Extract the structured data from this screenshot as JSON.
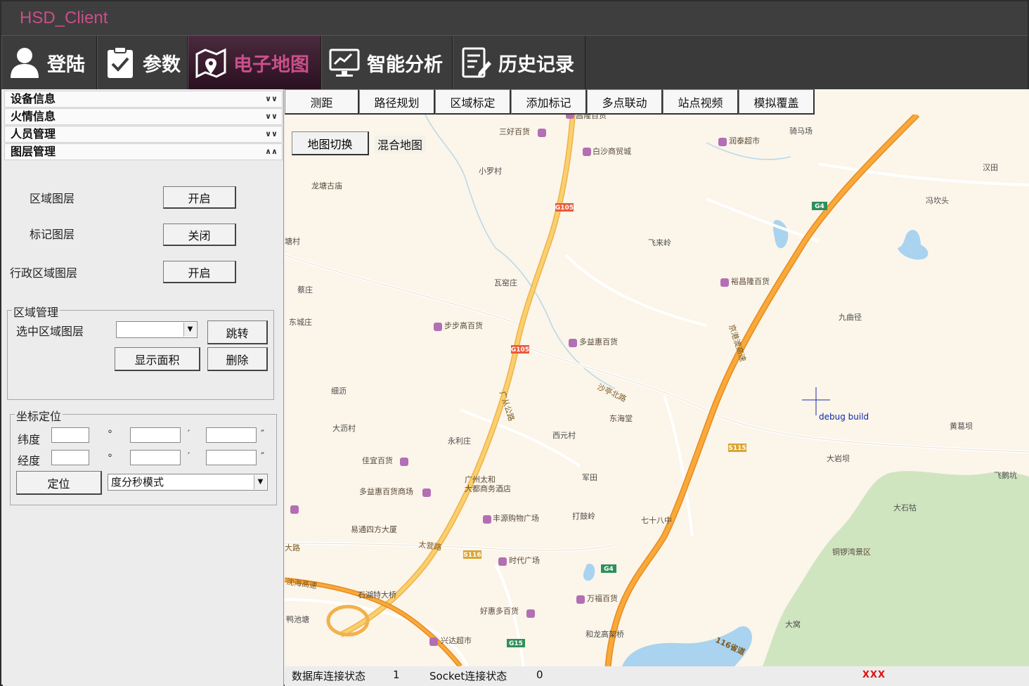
{
  "window": {
    "title": "HSD_Client"
  },
  "main_tabs": [
    {
      "label": "登陆",
      "icon": "user-icon"
    },
    {
      "label": "参数",
      "icon": "clipboard-check-icon"
    },
    {
      "label": "电子地图",
      "icon": "map-pin-icon",
      "active": true
    },
    {
      "label": "智能分析",
      "icon": "monitor-analysis-icon"
    },
    {
      "label": "历史记录",
      "icon": "edit-document-icon"
    }
  ],
  "accordion": [
    {
      "label": "设备信息",
      "expanded": false
    },
    {
      "label": "火情信息",
      "expanded": false
    },
    {
      "label": "人员管理",
      "expanded": false
    },
    {
      "label": "图层管理",
      "expanded": true
    }
  ],
  "layers": {
    "area_label": "区域图层",
    "area_btn": "开启",
    "marker_label": "标记图层",
    "marker_btn": "关闭",
    "admin_label": "行政区域图层",
    "admin_btn": "开启"
  },
  "area_mgmt": {
    "title": "区域管理",
    "select_label": "选中区域图层",
    "select_value": "",
    "jump_btn": "跳转",
    "show_area_btn": "显示面积",
    "delete_btn": "删除"
  },
  "coord": {
    "title": "坐标定位",
    "lat_label": "纬度",
    "lon_label": "经度",
    "deg_sym": "°",
    "min_sym": "′",
    "sec_sym": "″",
    "locate_btn": "定位",
    "mode_value": "度分秒模式"
  },
  "map_tools": [
    "测距",
    "路径规划",
    "区域标定",
    "添加标记",
    "多点联动",
    "站点视频",
    "模拟覆盖"
  ],
  "map": {
    "switch_btn": "地图切换",
    "map_type": "混合地图",
    "debug_text": "debug build",
    "labels": {
      "l1": "昌隆百货",
      "l2": "三好百货",
      "l3": "白沙商贸城",
      "l4": "润泰超市",
      "l5": "骑马场",
      "l6": "龙塘古庙",
      "l7": "小罗村",
      "l8": "汉田",
      "l9": "冯坎头",
      "l10": "塘村",
      "l11": "飞来岭",
      "l12": "瓦窑庄",
      "l13": "蔡庄",
      "l14": "裕昌隆百货",
      "l15": "九曲径",
      "l16": "东城庄",
      "l17": "步步高百货",
      "l18": "多益惠百货",
      "l19": "细沥",
      "l20": "东海堂",
      "l21": "大沥村",
      "l22": "永利庄",
      "l23": "西元村",
      "l24": "黄葛坝",
      "l25": "大岩坝",
      "l26": "佳宜百货",
      "l27": "广州太和",
      "l28": "大都商务酒店",
      "l29": "军田",
      "l30": "飞鹅坑",
      "l31": "多益惠百货商场",
      "l32": "大石牯",
      "l33": "丰源购物广场",
      "l34": "打鼓岭",
      "l35": "七十八中",
      "l36": "易通四方大厦",
      "l37": "铜锣湾景区",
      "l38": "大路",
      "l39": "太营路",
      "l40": "时代广场",
      "l41": "沈海高速",
      "l42": "石湖特大桥",
      "l43": "万福百货",
      "l44": "好惠多百货",
      "l45": "鸭池塘",
      "l46": "大窝",
      "l47": "兴达超市",
      "l48": "和龙高架桥",
      "l49": "沙亭北路",
      "l50": "京港澳高速",
      "l51": "广从公路"
    },
    "shields": {
      "g105a": "G105",
      "g105b": "G105",
      "g4a": "G4",
      "g4b": "G4",
      "s115": "S115",
      "s116": "S116",
      "g15": "G15",
      "r116": "116省道"
    }
  },
  "status": {
    "db_label": "数据库连接状态",
    "db_value": "1",
    "socket_label": "Socket连接状态",
    "socket_value": "0",
    "flag": "XXX"
  }
}
